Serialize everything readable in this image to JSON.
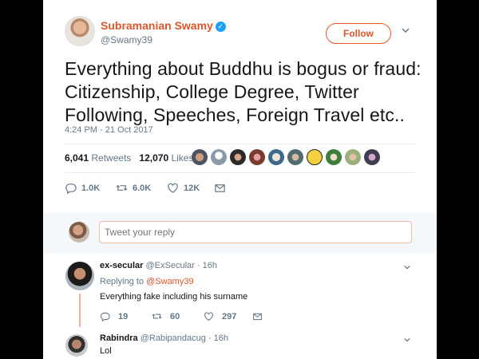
{
  "tweet": {
    "author_name": "Subramanian Swamy",
    "author_handle": "@Swamy39",
    "follow_label": "Follow",
    "text": "Everything about Buddhu is bogus or fraud: Citizenship, College Degree, Twitter Following, Speeches, Foreign Travel etc..",
    "timestamp": "4:24 PM - 21 Oct 2017",
    "retweets_count": "6,041",
    "retweets_label": "Retweets",
    "likes_count": "12,070",
    "likes_label": "Likes",
    "actions": {
      "replies": "1.0K",
      "retweets": "6.0K",
      "likes": "12K"
    }
  },
  "reply_box": {
    "placeholder": "Tweet your reply"
  },
  "replies": [
    {
      "name": "ex-secular",
      "handle": "@ExSecular",
      "time": "16h",
      "replying_prefix": "Replying to",
      "replying_to": "@Swamy39",
      "text": "Everything fake including his surname",
      "replies": "19",
      "retweets": "60",
      "likes": "297"
    },
    {
      "name": "Rabindra",
      "handle": "@Rabipandacug",
      "time": "16h",
      "text": "Lol"
    }
  ],
  "colors": {
    "accent": "#e0552a",
    "verified": "#1da1f2",
    "muted": "#657786"
  }
}
